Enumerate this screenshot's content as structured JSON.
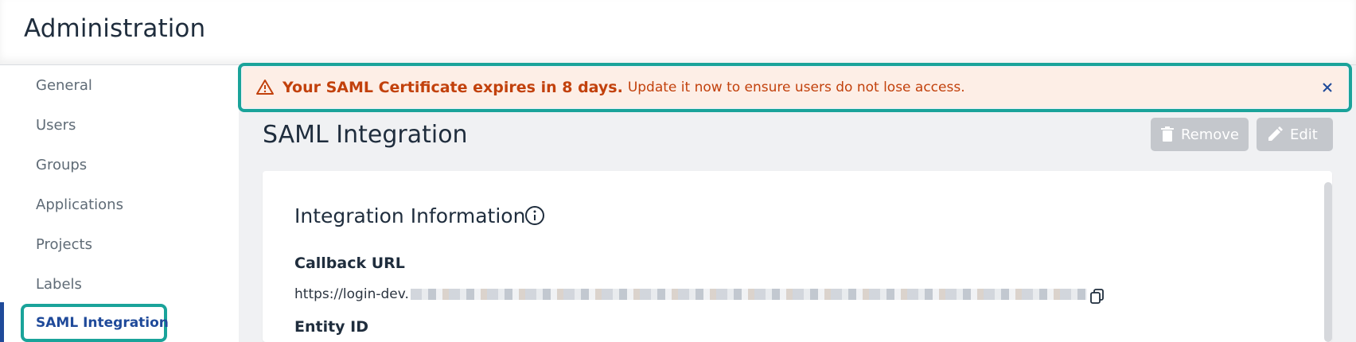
{
  "header": {
    "title": "Administration"
  },
  "sidebar": {
    "items": [
      {
        "label": "General"
      },
      {
        "label": "Users"
      },
      {
        "label": "Groups"
      },
      {
        "label": "Applications"
      },
      {
        "label": "Projects"
      },
      {
        "label": "Labels"
      },
      {
        "label": "SAML Integration",
        "active": true
      }
    ]
  },
  "alert": {
    "strong": "Your SAML Certificate expires in 8 days.",
    "text": "Update it now to ensure users do not lose access.",
    "icon": "warning-triangle-icon",
    "close_icon": "close-icon",
    "color": "#c2410c",
    "background": "#fdeee6"
  },
  "page": {
    "title": "SAML Integration",
    "remove_label": "Remove",
    "edit_label": "Edit"
  },
  "integration": {
    "section_title": "Integration Information",
    "callback_label": "Callback URL",
    "callback_value": "https://login-dev.",
    "entity_label": "Entity ID"
  },
  "colors": {
    "accent": "#1aa39a",
    "nav_active": "#1f4a9a"
  }
}
